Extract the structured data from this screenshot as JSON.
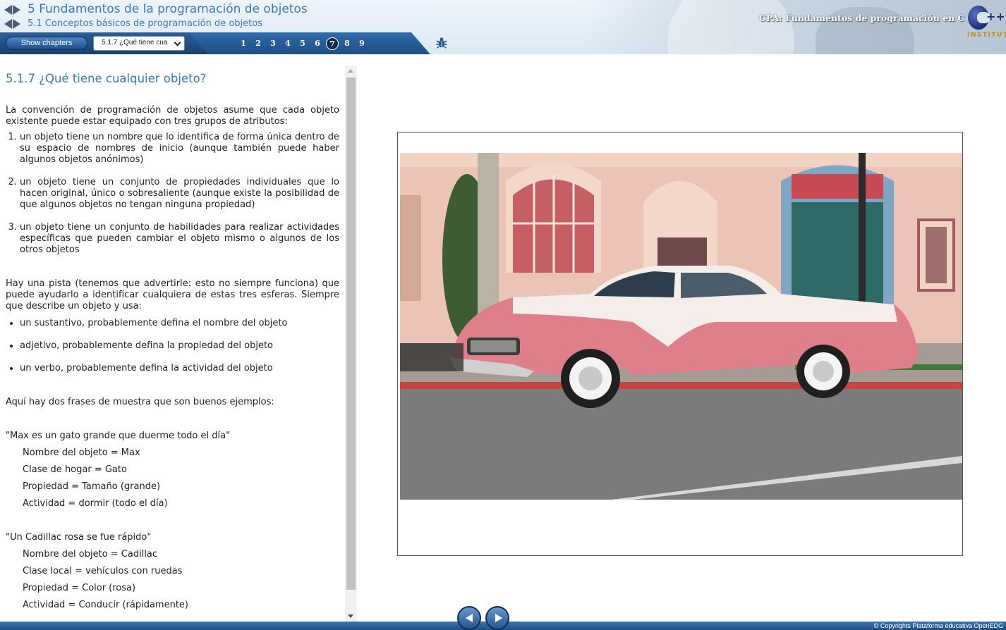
{
  "header": {
    "chapter_title": "5 Fundamentos de la programación de objetos",
    "section_title": "5.1 Conceptos básicos de programación de objetos",
    "course_title": "CPA: Fundamentos de programación en C ++",
    "logo_text": "C++ INSTITUTE",
    "logo_pp": "++",
    "logo_institute": "INSTITUTE"
  },
  "toolbar": {
    "show_chapters_label": "Show chapters",
    "page_select_value": "5.1.7 ¿Qué tiene cua",
    "pages": [
      "1",
      "2",
      "3",
      "4",
      "5",
      "6",
      "7",
      "8",
      "9"
    ],
    "active_page": "7",
    "bug_icon": "bug-icon"
  },
  "content": {
    "heading": "5.1.7 ¿Qué tiene cualquier objeto?",
    "intro": "La convención de programación de objetos asume que cada objeto existente puede estar equipado con tres grupos de atributos:",
    "attributes": [
      "un objeto tiene un nombre que lo identifica de forma única dentro de su espacio de nombres de inicio (aunque también puede haber algunos objetos anónimos)",
      "un objeto tiene un conjunto de propiedades individuales que lo hacen original, único o sobresaliente (aunque existe la posibilidad de que algunos objetos no tengan ninguna propiedad)",
      "un objeto tiene un conjunto de habilidades para realizar actividades específicas que pueden cambiar el objeto mismo o algunos de los otros objetos"
    ],
    "hint": "Hay una pista (tenemos que advertirle: esto no siempre funciona) que puede ayudarlo a identificar cualquiera de estas tres esferas. Siempre que describe un objeto y usa:",
    "hints": [
      "un sustantivo, probablemente defina el nombre del objeto",
      "adjetivo, probablemente defina la propiedad del objeto",
      "un verbo, probablemente defina la actividad del objeto"
    ],
    "examples_intro": "Aquí hay dos frases de muestra que son buenos ejemplos:",
    "example1": {
      "quote": "\"Max es un gato grande que duerme todo el día\"",
      "lines": [
        "Nombre del objeto = Max",
        "Clase de hogar = Gato",
        "Propiedad = Tamaño (grande)",
        "Actividad = dormir (todo el día)"
      ]
    },
    "example2": {
      "quote": "\"Un Cadillac rosa se fue rápido\"",
      "lines": [
        "Nombre del objeto = Cadillac",
        "Clase local = vehículos con ruedas",
        "Propiedad = Color (rosa)",
        "Actividad = Conducir (rápidamente)"
      ]
    }
  },
  "footer": {
    "copyright": "© Copyrights Plataforma educativa OpenEDG"
  },
  "colors": {
    "title_blue": "#3a7ab8",
    "toolbar_blue": "#1f4f86",
    "car_pink": "#e07f8c"
  }
}
